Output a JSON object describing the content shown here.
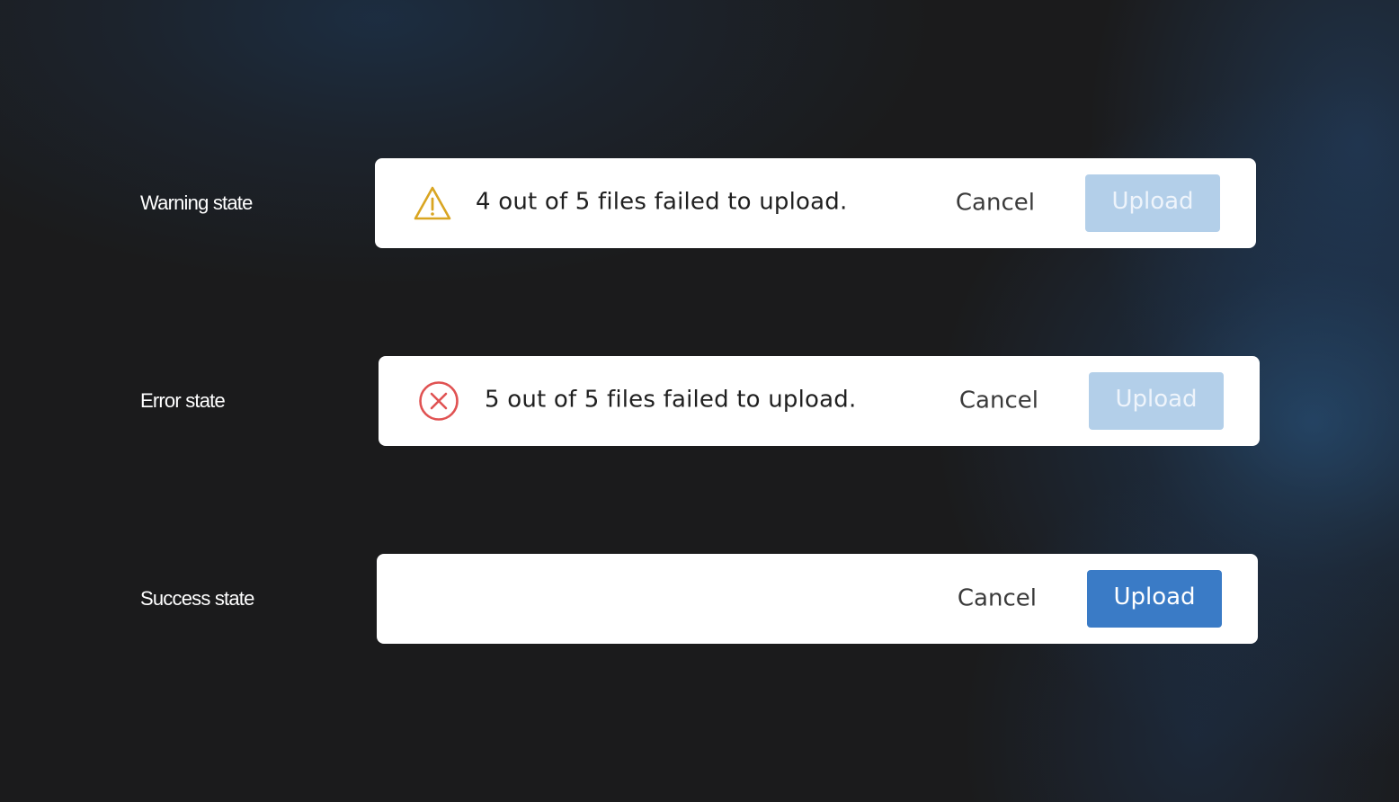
{
  "colors": {
    "background": "#1b1b1c",
    "warning": "#d9a521",
    "error": "#e05252",
    "upload_disabled": "#b3cfe9",
    "upload_enabled": "#3a7bc6"
  },
  "states": [
    {
      "label": "Warning state",
      "icon": "warning-triangle-icon",
      "message": "4 out of 5 files failed to upload.",
      "cancel_label": "Cancel",
      "upload_label": "Upload",
      "upload_enabled": false
    },
    {
      "label": "Error state",
      "icon": "error-circle-x-icon",
      "message": "5 out of 5 files failed to upload.",
      "cancel_label": "Cancel",
      "upload_label": "Upload",
      "upload_enabled": false
    },
    {
      "label": "Success state",
      "icon": "",
      "message": "",
      "cancel_label": "Cancel",
      "upload_label": "Upload",
      "upload_enabled": true
    }
  ]
}
